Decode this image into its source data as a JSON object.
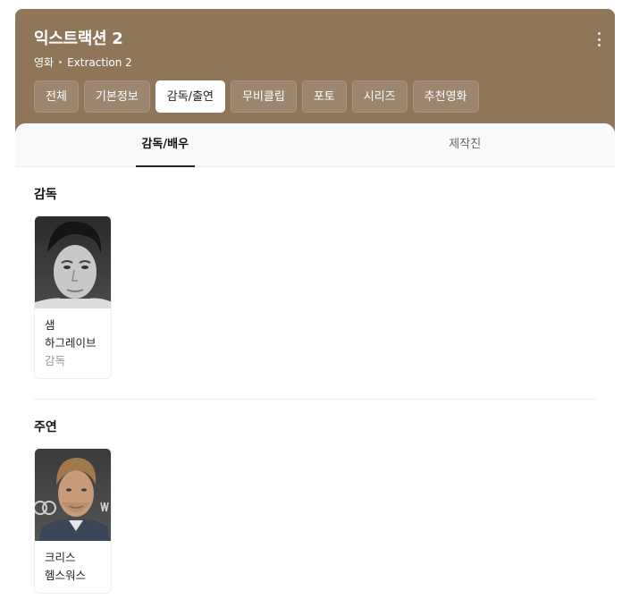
{
  "header": {
    "title": "익스트랙션 2",
    "category": "영화",
    "english_title": "Extraction 2",
    "more_icon": "more-vertical-icon"
  },
  "tabs": [
    {
      "label": "전체",
      "active": false
    },
    {
      "label": "기본정보",
      "active": false
    },
    {
      "label": "감독/출연",
      "active": true
    },
    {
      "label": "무비클립",
      "active": false
    },
    {
      "label": "포토",
      "active": false
    },
    {
      "label": "시리즈",
      "active": false
    },
    {
      "label": "추천영화",
      "active": false
    }
  ],
  "subtabs": [
    {
      "label": "감독/배우",
      "active": true
    },
    {
      "label": "제작진",
      "active": false
    }
  ],
  "sections": {
    "director": {
      "title": "감독",
      "people": [
        {
          "name": "샘 하그레이브",
          "role": "감독"
        }
      ]
    },
    "lead": {
      "title": "주연",
      "people": [
        {
          "name": "크리스 헴스워스"
        }
      ]
    }
  },
  "colors": {
    "header_bg": "#8f7659",
    "panel_bg": "#ffffff",
    "subtab_bg": "#f8f9fa"
  }
}
